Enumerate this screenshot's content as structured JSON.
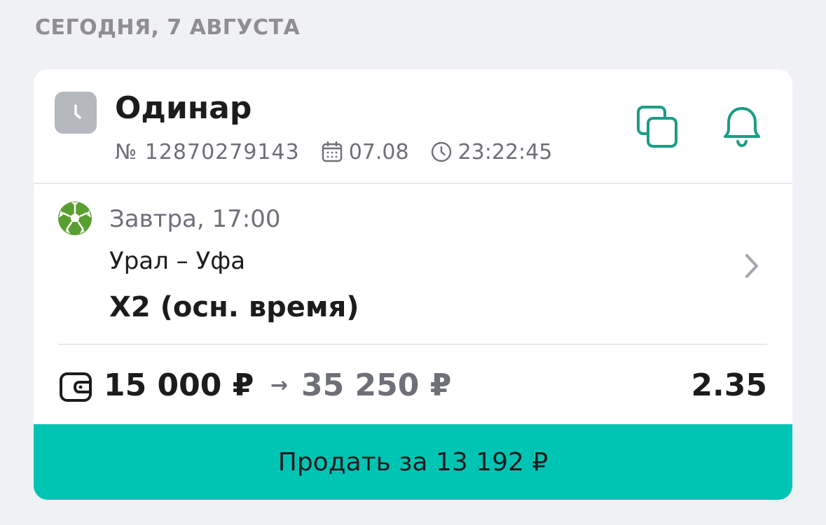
{
  "section": {
    "date_label": "СЕГОДНЯ, 7 АВГУСТА"
  },
  "bet": {
    "type": "Одинар",
    "number": "№ 12870279143",
    "date": "07.08",
    "time": "23:22:45",
    "status_icon": "clock-icon"
  },
  "actions": {
    "copy_icon": "copy-icon",
    "bell_icon": "bell-icon"
  },
  "event": {
    "sport_icon": "soccer-ball-icon",
    "start": "Завтра, 17:00",
    "teams": "Урал – Уфа",
    "outcome": "X2 (осн. время)"
  },
  "amounts": {
    "stake": "15 000 ₽",
    "arrow": "→",
    "payout": "35 250 ₽",
    "odds": "2.35"
  },
  "sell": {
    "label": "Продать за 13 192 ₽"
  },
  "colors": {
    "accent": "#00c4b3",
    "icon_green": "#1a9d86",
    "ball_green": "#5a9e32",
    "status_gray": "#b6b8c0",
    "text_primary": "#1c1c1e",
    "text_secondary": "#6e7078",
    "background": "#f0f1f5"
  }
}
